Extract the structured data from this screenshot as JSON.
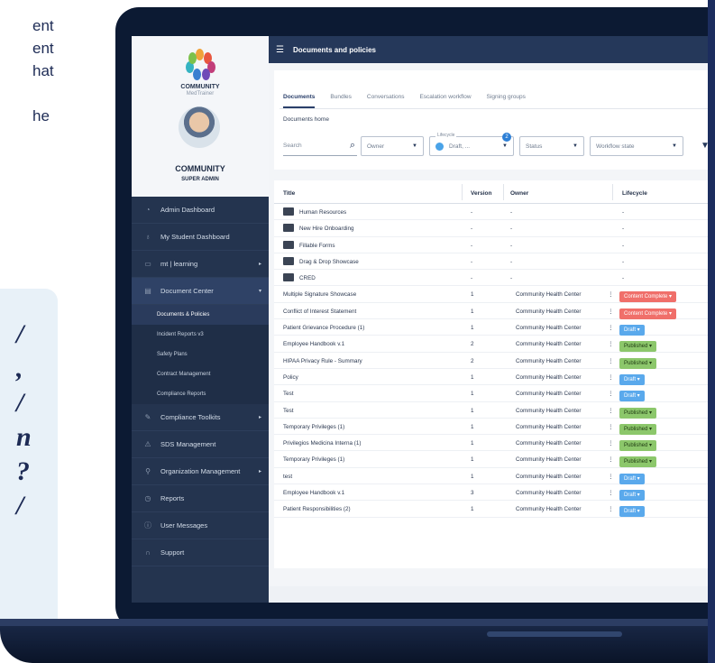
{
  "marketing": {
    "lines": [
      "ent",
      "ent",
      "hat",
      "",
      "he"
    ],
    "quote_glyphs": [
      "/",
      ",",
      "/",
      "n",
      "?",
      "/"
    ]
  },
  "brand": {
    "name": "COMMUNITY",
    "sub": "MedTrainer"
  },
  "user": {
    "name": "COMMUNITY",
    "role": "SUPER ADMIN"
  },
  "nav": {
    "items": [
      {
        "label": "Admin Dashboard",
        "icon": "dashboard-icon",
        "glyph": "◔",
        "arrow": ""
      },
      {
        "label": "My Student Dashboard",
        "icon": "graduation-cap-icon",
        "glyph": "♁",
        "arrow": ""
      },
      {
        "label": "mt | learning",
        "icon": "book-icon",
        "glyph": "▭",
        "arrow": "▸"
      },
      {
        "label": "Document Center",
        "icon": "document-icon",
        "glyph": "▤",
        "arrow": "▾"
      }
    ],
    "sub_items": [
      "Documents & Policies",
      "Incident Reports v3",
      "Safety Plans",
      "Contract Management",
      "Compliance Reports"
    ],
    "items_after": [
      {
        "label": "Compliance Toolkits",
        "icon": "toolkit-icon",
        "glyph": "✎",
        "arrow": "▸"
      },
      {
        "label": "SDS Management",
        "icon": "hazard-icon",
        "glyph": "⚠",
        "arrow": ""
      },
      {
        "label": "Organization Management",
        "icon": "organization-icon",
        "glyph": "⚲",
        "arrow": "▸"
      },
      {
        "label": "Reports",
        "icon": "reports-icon",
        "glyph": "◷",
        "arrow": ""
      },
      {
        "label": "User Messages",
        "icon": "messages-icon",
        "glyph": "ⓘ",
        "arrow": ""
      },
      {
        "label": "Support",
        "icon": "headset-icon",
        "glyph": "∩",
        "arrow": ""
      }
    ]
  },
  "topbar": {
    "title": "Documents and policies"
  },
  "tabs": [
    "Documents",
    "Bundles",
    "Conversations",
    "Escalation workflow",
    "Signing groups"
  ],
  "breadcrumb": "Documents home",
  "filters": {
    "search_placeholder": "Search",
    "owner": "Owner",
    "lifecycle_label": "Lifecycle",
    "lifecycle_value": "Draft, ...",
    "lifecycle_count": "2",
    "status": "Status",
    "workflow": "Workflow state"
  },
  "table": {
    "headers": [
      "Title",
      "Version",
      "Owner",
      "Lifecycle"
    ],
    "folders": [
      {
        "title": "Human Resources",
        "version": "-",
        "owner": "-",
        "lifecycle": "-"
      },
      {
        "title": "New Hire Onboarding",
        "version": "-",
        "owner": "-",
        "lifecycle": "-"
      },
      {
        "title": "Fillable Forms",
        "version": "-",
        "owner": "-",
        "lifecycle": "-"
      },
      {
        "title": "Drag & Drop Showcase",
        "version": "-",
        "owner": "-",
        "lifecycle": "-"
      },
      {
        "title": "CRED",
        "version": "-",
        "owner": "-",
        "lifecycle": "-"
      }
    ],
    "rows": [
      {
        "title": "Multiple Signature Showcase",
        "version": "1",
        "owner": "Community Health Center",
        "lifecycle": "Content Complete",
        "color": "#f06f6a"
      },
      {
        "title": "Conflict of Interest Statement",
        "version": "1",
        "owner": "Community Health Center",
        "lifecycle": "Content Complete",
        "color": "#f06f6a"
      },
      {
        "title": "Patient Grievance Procedure (1)",
        "version": "1",
        "owner": "Community Health Center",
        "lifecycle": "Draft",
        "color": "#5aa9ec"
      },
      {
        "title": "Employee Handbook v.1",
        "version": "2",
        "owner": "Community Health Center",
        "lifecycle": "Published",
        "color": "#8cc76b"
      },
      {
        "title": "HIPAA Privacy Rule - Summary",
        "version": "2",
        "owner": "Community Health Center",
        "lifecycle": "Published",
        "color": "#8cc76b"
      },
      {
        "title": "Policy",
        "version": "1",
        "owner": "Community Health Center",
        "lifecycle": "Draft",
        "color": "#5aa9ec"
      },
      {
        "title": "Test",
        "version": "1",
        "owner": "Community Health Center",
        "lifecycle": "Draft",
        "color": "#5aa9ec"
      },
      {
        "title": "Test",
        "version": "1",
        "owner": "Community Health Center",
        "lifecycle": "Published",
        "color": "#8cc76b"
      },
      {
        "title": "Temporary Privileges (1)",
        "version": "1",
        "owner": "Community Health Center",
        "lifecycle": "Published",
        "color": "#8cc76b"
      },
      {
        "title": "Privilegios Medicina Interna (1)",
        "version": "1",
        "owner": "Community Health Center",
        "lifecycle": "Published",
        "color": "#8cc76b"
      },
      {
        "title": "Temporary Privileges (1)",
        "version": "1",
        "owner": "Community Health Center",
        "lifecycle": "Published",
        "color": "#8cc76b"
      },
      {
        "title": "test",
        "version": "1",
        "owner": "Community Health Center",
        "lifecycle": "Draft",
        "color": "#5aa9ec"
      },
      {
        "title": "Employee Handbook v.1",
        "version": "3",
        "owner": "Community Health Center",
        "lifecycle": "Draft",
        "color": "#5aa9ec"
      },
      {
        "title": "Patient Responsibilities (2)",
        "version": "1",
        "owner": "Community Health Center",
        "lifecycle": "Draft",
        "color": "#5aa9ec"
      }
    ]
  }
}
